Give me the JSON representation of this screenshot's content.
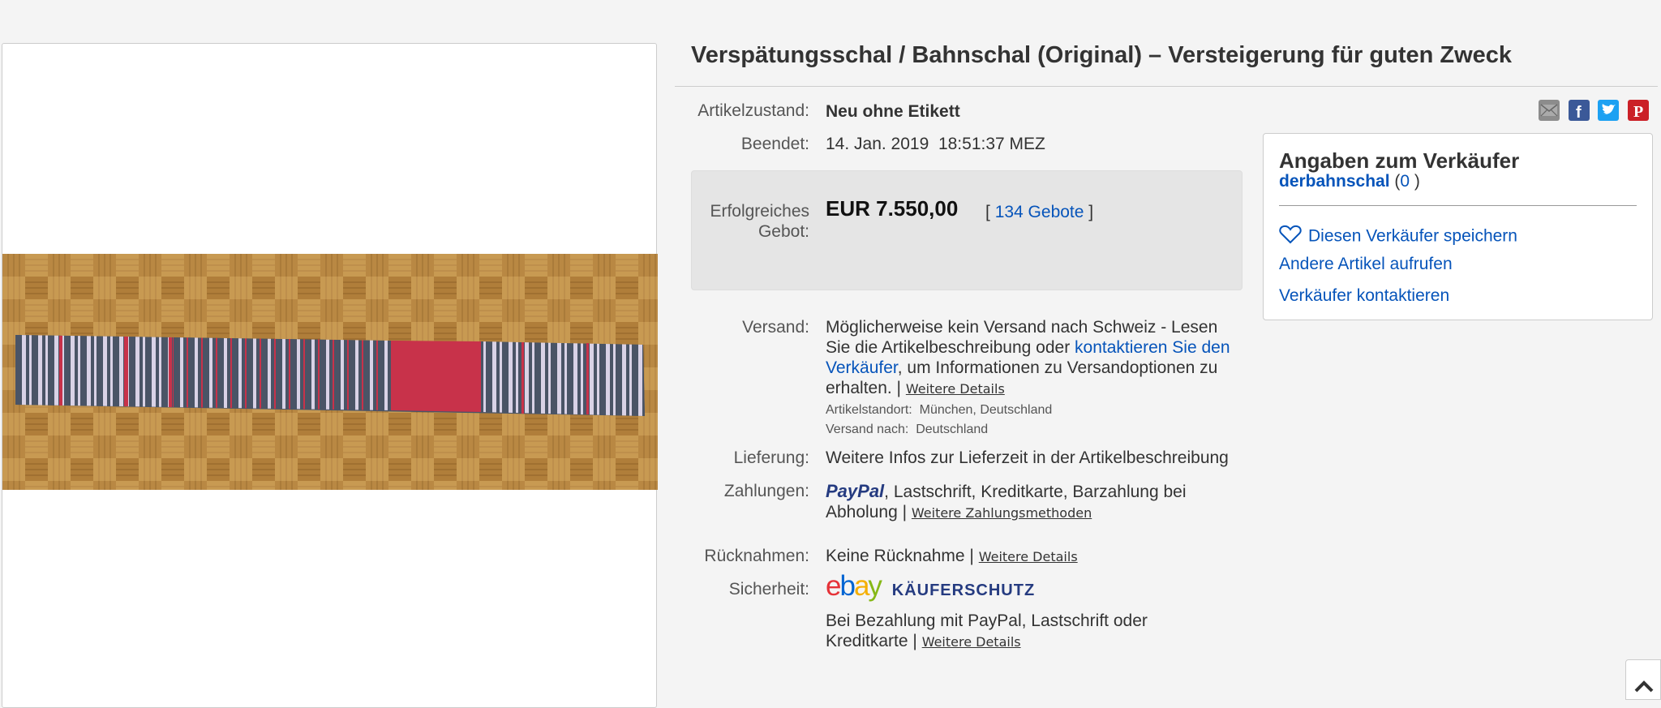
{
  "listing": {
    "title": "Verspätungsschal / Bahnschal (Original) – Versteigerung für guten Zweck",
    "condition_label": "Artikelzustand:",
    "condition_value": "Neu ohne Etikett",
    "ended_label": "Beendet:",
    "ended_value": "14. Jan. 2019  18:51:37 MEZ",
    "bid_label_line1": "Erfolgreiches",
    "bid_label_line2": "Gebot:",
    "price": "EUR 7.550,00",
    "bids_open": "[",
    "bids_link": "134 Gebote",
    "bids_close": "]"
  },
  "shipping": {
    "label": "Versand:",
    "line1": "Möglicherweise kein Versand nach Schweiz - Lesen",
    "line2_pre": "Sie die Artikelbeschreibung oder ",
    "line2_link": "kontaktieren Sie den",
    "line3_link": "Verkäufer",
    "line3_post": ", um Informationen zu Versandoptionen zu",
    "line4": "erhalten. |",
    "details_link": "Weitere Details",
    "location_label": "Artikelstandort:",
    "location_value": "München, Deutschland",
    "shipto_label": "Versand nach:",
    "shipto_value": "Deutschland"
  },
  "delivery": {
    "label": "Lieferung:",
    "value": "Weitere Infos zur Lieferzeit in der Artikelbeschreibung"
  },
  "payments": {
    "label": "Zahlungen:",
    "paypal": "PayPal",
    "line1_rest": ",  Lastschrift,  Kreditkarte,  Barzahlung bei",
    "line2": "Abholung  |",
    "more_link": "Weitere Zahlungsmethoden"
  },
  "returns": {
    "label": "Rücknahmen:",
    "value": "Keine Rücknahme |",
    "details_link": "Weitere Details"
  },
  "security": {
    "label": "Sicherheit:",
    "ebay_e": "e",
    "ebay_b": "b",
    "ebay_a": "a",
    "ebay_y": "y",
    "protection": "KÄUFERSCHUTZ",
    "line1": "Bei Bezahlung mit PayPal, Lastschrift oder",
    "line2": "Kreditkarte |",
    "details_link": "Weitere Details"
  },
  "seller": {
    "heading": "Angaben zum Verkäufer",
    "name": "derbahnschal",
    "score_open": "(",
    "score": "0",
    "score_close": " )",
    "save": "Diesen Verkäufer speichern",
    "other_items": "Andere Artikel aufrufen",
    "contact": "Verkäufer kontaktieren"
  },
  "share_icons": [
    "mail-icon",
    "facebook-icon",
    "twitter-icon",
    "pinterest-icon"
  ],
  "colors": {
    "link": "#0654ba",
    "facebook": "#3b5998",
    "twitter": "#1da1f2",
    "pinterest": "#cb2027",
    "mail": "#8c8c8c"
  }
}
